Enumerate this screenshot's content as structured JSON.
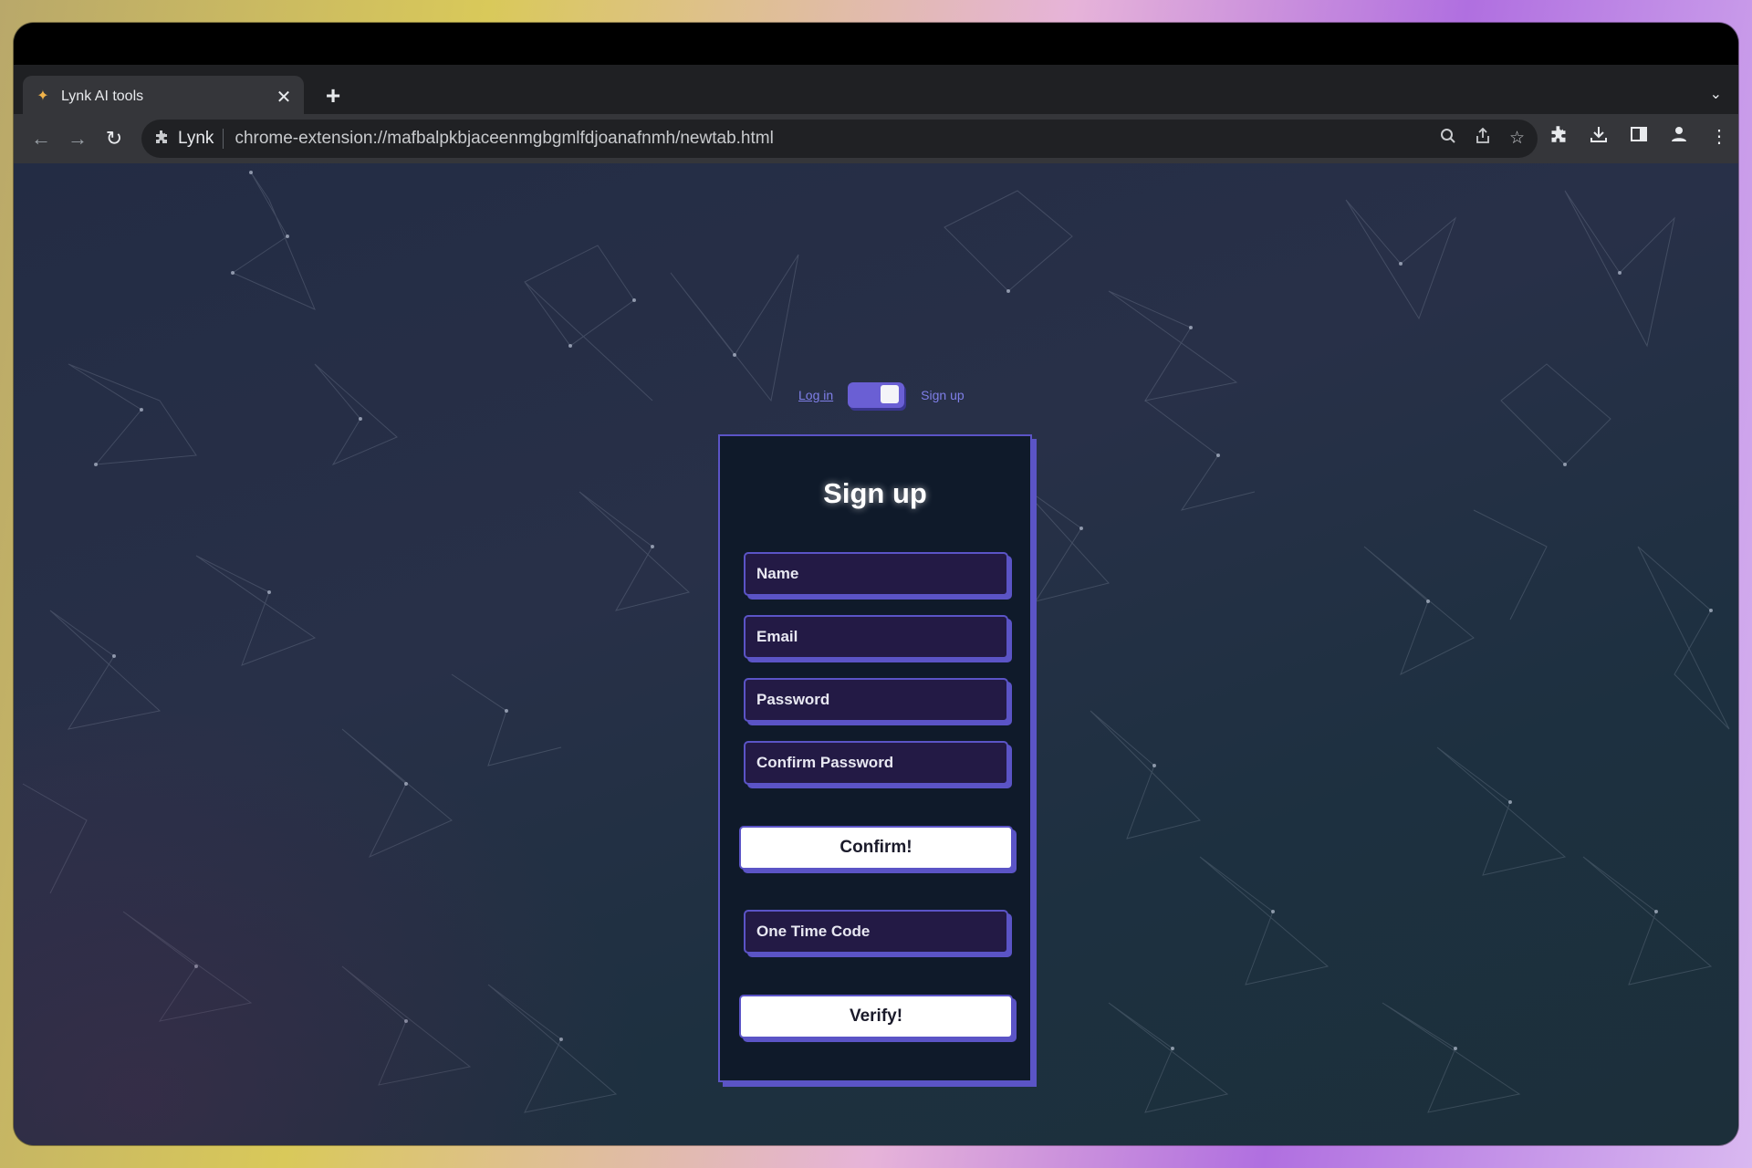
{
  "browser": {
    "tab_title": "Lynk AI tools",
    "tab_close": "✕",
    "new_tab": "+",
    "tab_list": "⌄",
    "site_name": "Lynk",
    "url": "chrome-extension://mafbalpkbjaceenmgbgmlfdjoanafnmh/newtab.html"
  },
  "auth": {
    "toggle_left": "Log in",
    "toggle_right": "Sign up",
    "toggle_state": "sign-up"
  },
  "form": {
    "title": "Sign up",
    "name_placeholder": "Name",
    "email_placeholder": "Email",
    "password_placeholder": "Password",
    "confirm_password_placeholder": "Confirm Password",
    "confirm_label": "Confirm!",
    "otp_placeholder": "One Time Code",
    "verify_label": "Verify!"
  },
  "colors": {
    "accent": "#5b54c6",
    "card_bg": "#0f1a2a",
    "field_bg": "#231a45",
    "link": "#7f7fe8"
  },
  "icons": [
    "back-icon",
    "forward-icon",
    "reload-icon",
    "extension-icon",
    "zoom-icon",
    "share-icon",
    "bookmark-star-icon",
    "extensions-puzzle-icon",
    "download-icon",
    "side-panel-icon",
    "profile-icon",
    "menu-icon"
  ]
}
